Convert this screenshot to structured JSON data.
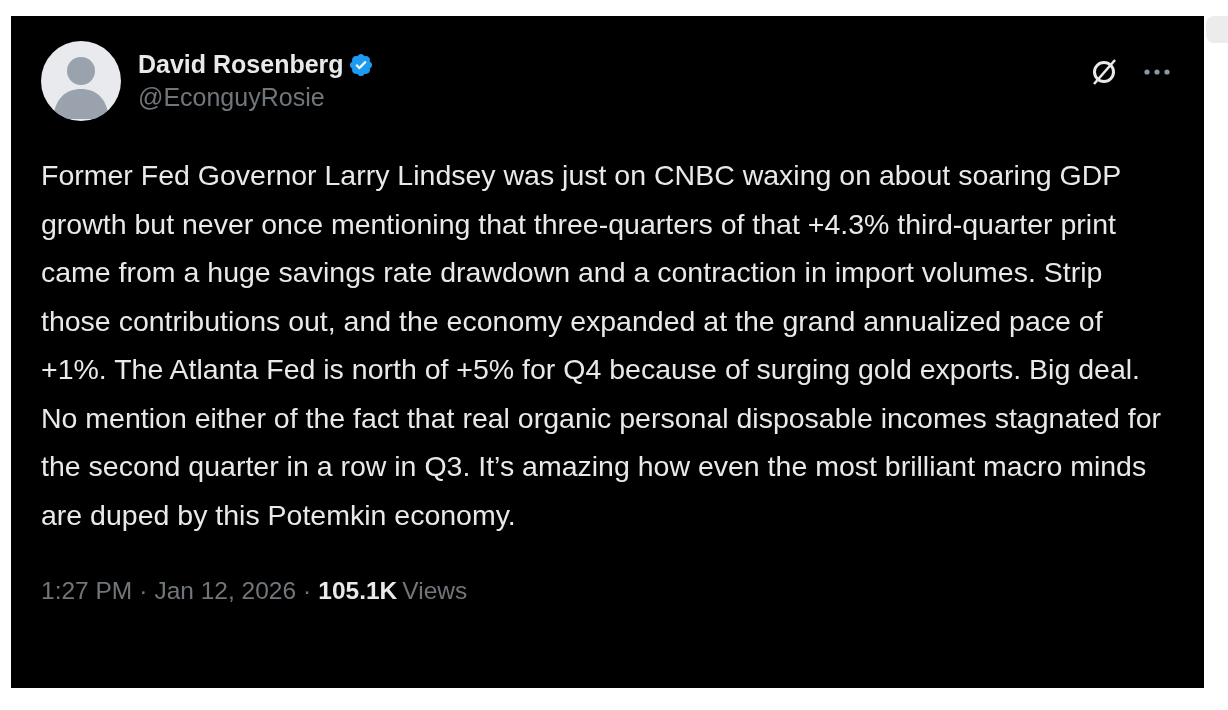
{
  "author": {
    "name": "David Rosenberg",
    "verified": true,
    "handle": "@EconguyRosie"
  },
  "text": "Former Fed Governor Larry Lindsey was just on CNBC waxing on about soaring GDP growth but never once mentioning that three-quarters of that +4.3% third-quarter print came from a huge savings rate drawdown and a contraction in import volumes. Strip those contributions out, and the economy expanded at the grand annualized pace of +1%. The Atlanta Fed is north of +5% for Q4 because of surging gold exports. Big deal. No mention either of the fact that real organic personal disposable incomes stagnated for the second quarter in a row in Q3. It’s amazing how even the most brilliant macro minds are duped by this Potemkin economy.",
  "footer": {
    "time": "1:27 PM",
    "separator_1": "·",
    "date": "Jan 12, 2026",
    "separator_2": "·",
    "views_count": "105.1K",
    "views_label": "Views"
  }
}
